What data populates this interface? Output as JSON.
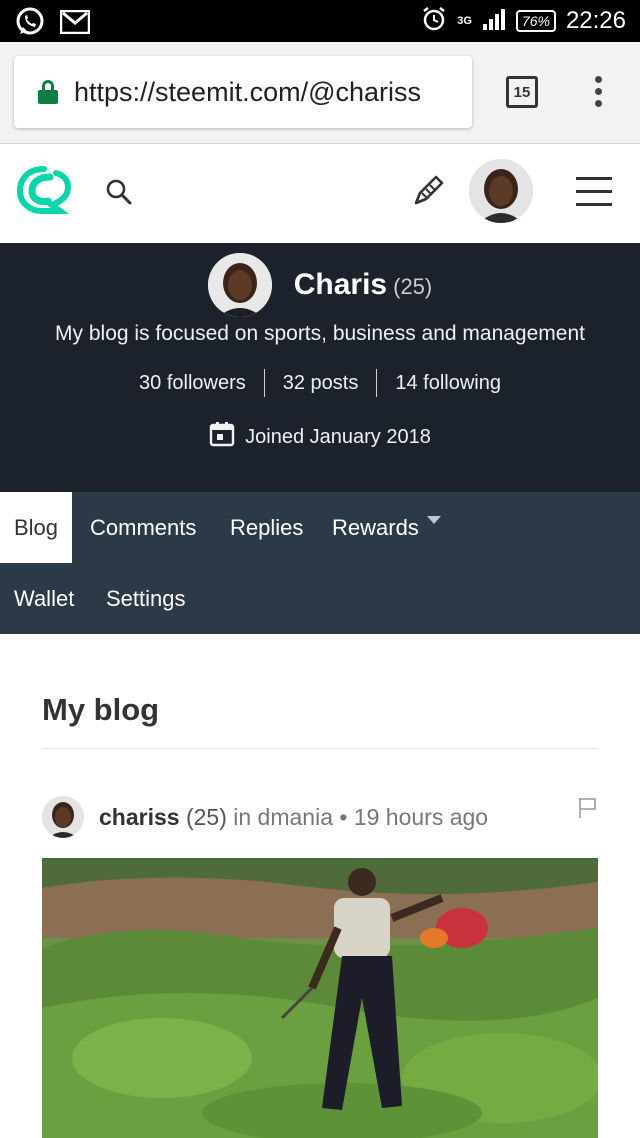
{
  "status_bar": {
    "network": "3G",
    "battery": "76%",
    "time": "22:26"
  },
  "browser": {
    "url": "https://steemit.com/@chariss",
    "tab_count": "15"
  },
  "profile": {
    "name": "Charis",
    "reputation": "(25)",
    "about": "My blog is focused on sports, business and management",
    "followers": "30 followers",
    "posts": "32 posts",
    "following": "14 following",
    "joined": "Joined January 2018"
  },
  "tabs": {
    "blog": "Blog",
    "comments": "Comments",
    "replies": "Replies",
    "rewards": "Rewards",
    "wallet": "Wallet",
    "settings": "Settings"
  },
  "main": {
    "section_title": "My blog"
  },
  "post": {
    "author": "chariss",
    "reputation": "(25)",
    "in_label": "in",
    "category": "dmania",
    "separator": "•",
    "time_ago": "19 hours ago"
  },
  "colors": {
    "brand_teal": "#06d6a9",
    "banner_bg": "#1b222b",
    "tabs_bg": "#2c3a48",
    "lock_green": "#0b8043"
  },
  "icons": {
    "whatsapp": "whatsapp-icon",
    "gmail": "gmail-icon",
    "alarm": "alarm-icon",
    "signal": "signal-icon",
    "lock": "lock-icon",
    "search": "search-icon",
    "pencil": "pencil-icon",
    "menu": "menu-icon",
    "calendar": "calendar-icon",
    "flag": "flag-icon",
    "more": "more-vert-icon"
  }
}
